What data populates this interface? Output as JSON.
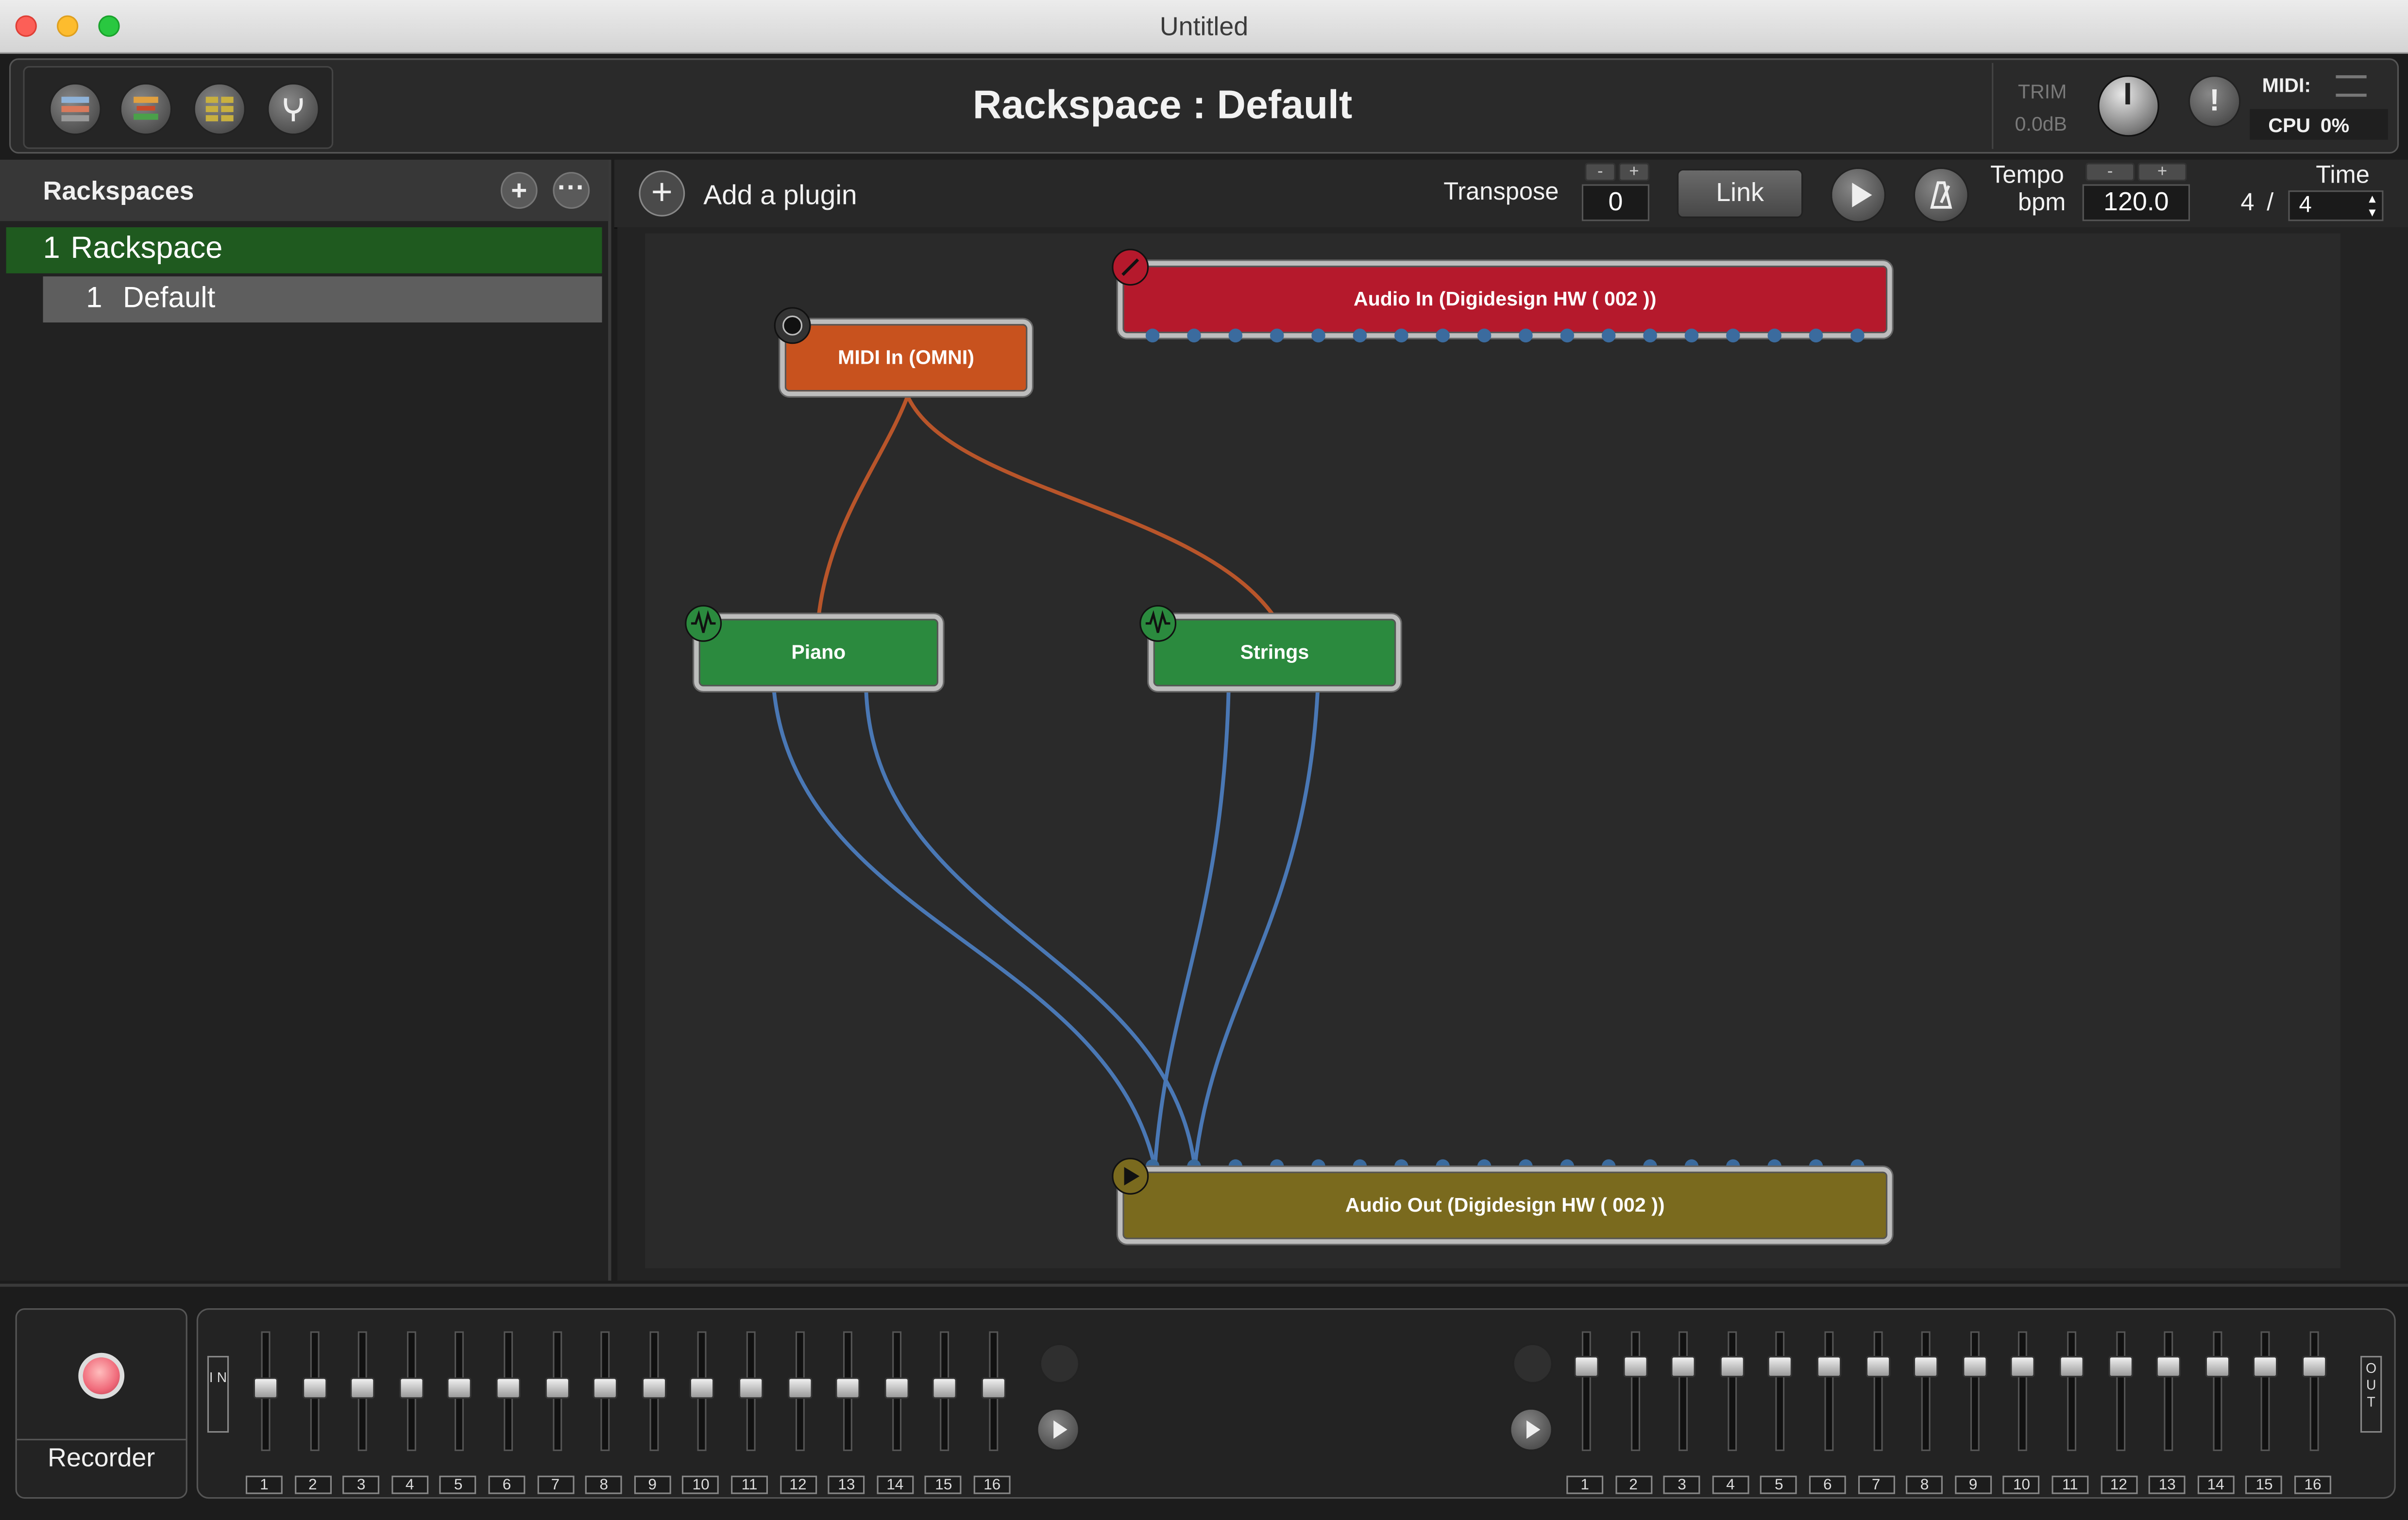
{
  "window": {
    "title": "Untitled"
  },
  "toolbar": {
    "rackspace_title": "Rackspace : Default",
    "trim_label": "TRIM",
    "trim_value": "0.0dB",
    "midi_label": "MIDI:",
    "cpu_label": "CPU",
    "cpu_value": "0%",
    "icons": [
      "rack-view-icon",
      "setlist-view-icon",
      "panels-view-icon",
      "tuner-icon"
    ]
  },
  "sidebar": {
    "title": "Rackspaces",
    "rackspaces": [
      {
        "number": "1",
        "name": "Rackspace",
        "variations": [
          {
            "number": "1",
            "name": "Default"
          }
        ]
      }
    ]
  },
  "canvas_header": {
    "add_plugin_label": "Add a plugin",
    "transpose_label": "Transpose",
    "transpose_value": "0",
    "link_label": "Link",
    "tempo_label": "Tempo",
    "bpm_label": "bpm",
    "tempo_value": "120.0",
    "time_label": "Time",
    "time_numerator": "4",
    "time_separator": "/",
    "time_denominator": "4"
  },
  "plugins": {
    "audio_in": "Audio In (Digidesign HW ( 002 ))",
    "midi_in": "MIDI In (OMNI)",
    "piano": "Piano",
    "strings": "Strings",
    "audio_out": "Audio Out (Digidesign HW ( 002 ))"
  },
  "colors": {
    "audio_in": "#b5192c",
    "midi_in": "#c8521e",
    "instrument": "#2b8a3e",
    "audio_out": "#7a6a1e",
    "midi_cable": "#b8552a",
    "audio_cable": "#4a78b5",
    "selected_rackspace": "#1f5a1f"
  },
  "mixer": {
    "recorder_label": "Recorder",
    "in_tag": "I N",
    "out_tag": "O U T",
    "input_channels": [
      "1",
      "2",
      "3",
      "4",
      "5",
      "6",
      "7",
      "8",
      "9",
      "10",
      "11",
      "12",
      "13",
      "14",
      "15",
      "16"
    ],
    "output_channels": [
      "1",
      "2",
      "3",
      "4",
      "5",
      "6",
      "7",
      "8",
      "9",
      "10",
      "11",
      "12",
      "13",
      "14",
      "15",
      "16"
    ]
  }
}
